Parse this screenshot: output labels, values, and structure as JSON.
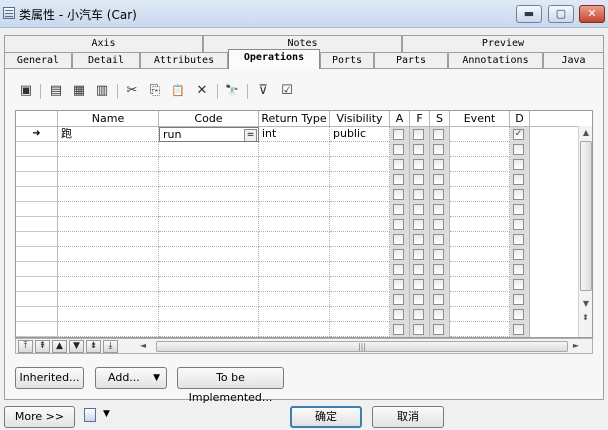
{
  "window": {
    "title": "类属性 - 小汽车 (Car)",
    "minimize_glyph": "▬",
    "maximize_glyph": "▢",
    "close_glyph": "✕"
  },
  "tabs_row1": [
    {
      "label": "Axis"
    },
    {
      "label": "Notes"
    },
    {
      "label": "Preview"
    }
  ],
  "tabs_row2": [
    {
      "label": "General"
    },
    {
      "label": "Detail"
    },
    {
      "label": "Attributes"
    },
    {
      "label": "Operations",
      "active": true
    },
    {
      "label": "Ports"
    },
    {
      "label": "Parts"
    },
    {
      "label": "Annotations"
    },
    {
      "label": "Java"
    }
  ],
  "toolbar": [
    {
      "icon": "properties-icon",
      "glyph": "▣"
    },
    {
      "icon": "insert-row-icon",
      "glyph": "▤"
    },
    {
      "icon": "add-row-icon",
      "glyph": "▦"
    },
    {
      "icon": "add-existing-icon",
      "glyph": "▥"
    },
    {
      "icon": "cut-icon",
      "glyph": "✂"
    },
    {
      "icon": "copy-icon",
      "glyph": "⎘"
    },
    {
      "icon": "paste-icon",
      "glyph": "📋"
    },
    {
      "icon": "delete-icon",
      "glyph": "✕"
    },
    {
      "icon": "find-icon",
      "glyph": "🔭"
    },
    {
      "icon": "filter-icon",
      "glyph": "⊽"
    },
    {
      "icon": "customize-columns-icon",
      "glyph": "☑"
    }
  ],
  "grid": {
    "columns": [
      "Name",
      "Code",
      "Return Type",
      "Visibility",
      "A",
      "F",
      "S",
      "Event",
      "D"
    ],
    "rows": [
      {
        "marker": "➜",
        "name": "跑",
        "code": "run",
        "return_type": "int",
        "visibility": "public",
        "a": false,
        "f": false,
        "s": false,
        "event": "",
        "d": true
      }
    ],
    "empty_row_count": 13,
    "code_button_glyph": "="
  },
  "nav_buttons": [
    "⤒",
    "⇞",
    "▲",
    "▼",
    "⇟",
    "⤓"
  ],
  "scroll": {
    "up": "▲",
    "down": "▼",
    "left": "◄",
    "right": "►",
    "thumb_grip": "|||",
    "split_up": "⬍"
  },
  "buttons": {
    "inherited": "Inherited...",
    "add": "Add...",
    "add_arrow": "▼",
    "to_be_implemented": "To be Implemented...",
    "more": "More >>",
    "ok": "确定",
    "cancel": "取消"
  }
}
